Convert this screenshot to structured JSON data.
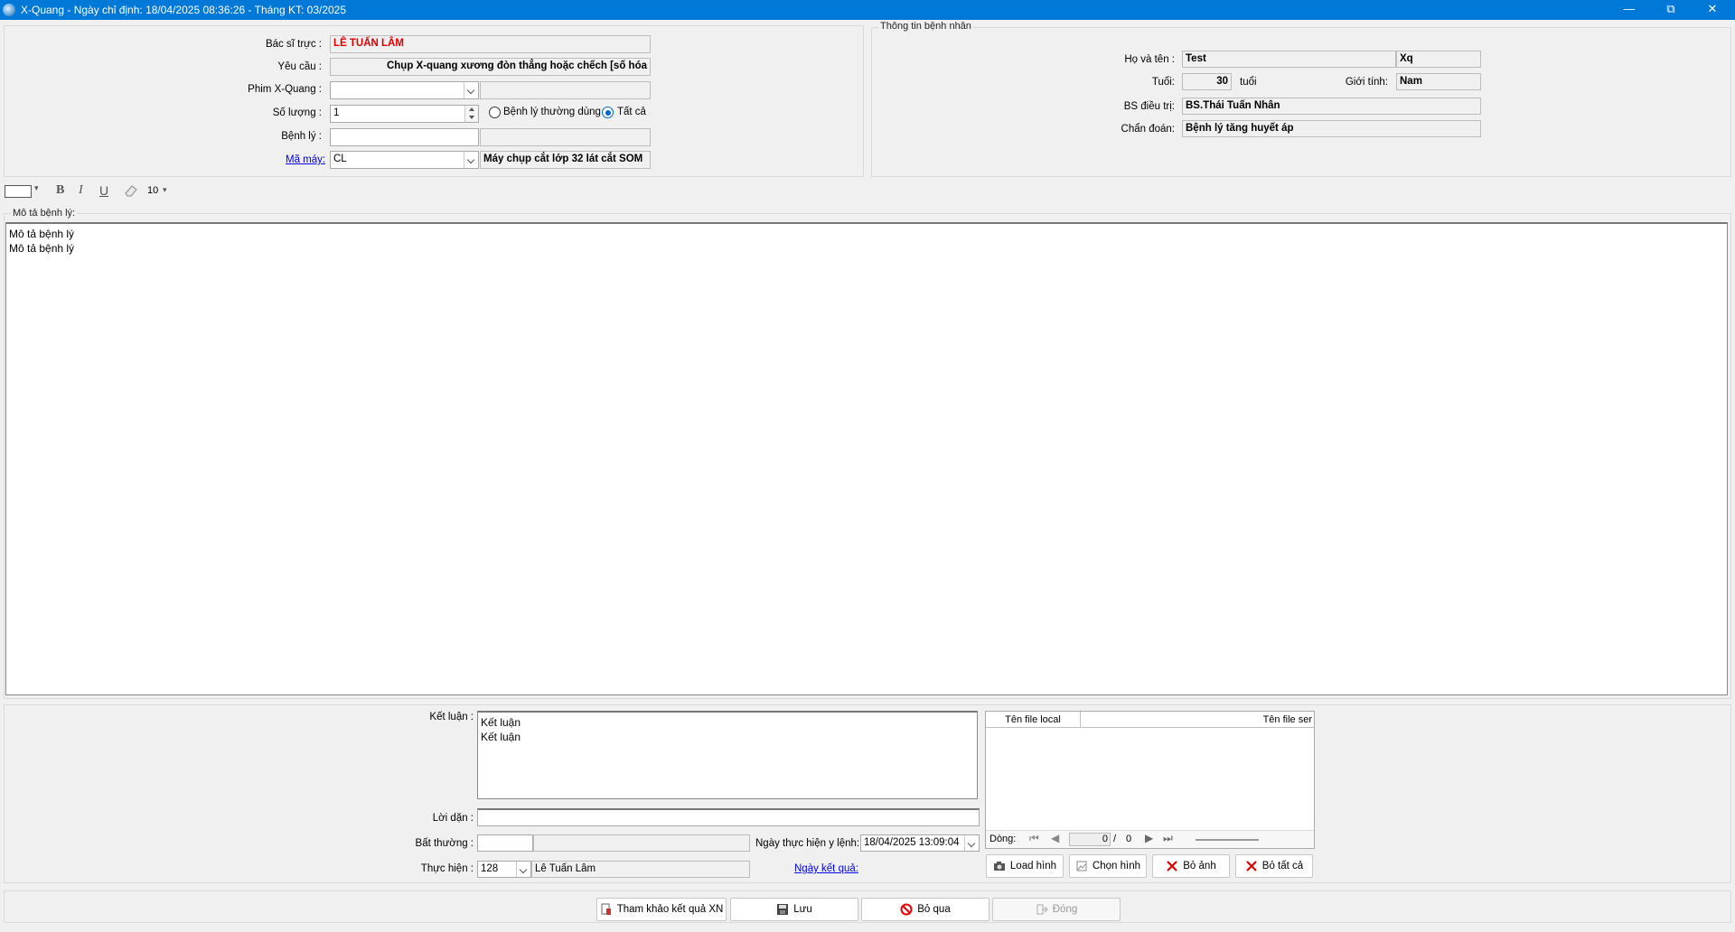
{
  "window": {
    "title": "X-Quang - Ngày chỉ định: 18/04/2025 08:36:26 - Tháng KT: 03/2025",
    "minimize": "—",
    "restore": "⧉",
    "close": "✕"
  },
  "order": {
    "bac_si_truc_label": "Bác sĩ trực :",
    "bac_si_truc_value": "LÊ TUẤN LÂM",
    "yeu_cau_label": "Yêu cầu :",
    "yeu_cau_value": "Chụp X-quang xương đòn thẳng hoặc chếch [số hóa",
    "phim_label": "Phim X-Quang :",
    "phim_value": "",
    "so_luong_label": "Số lượng :",
    "so_luong_value": "1",
    "radio_thuong_dung": "Bệnh lý thường dùng",
    "radio_tat_ca": "Tất cả",
    "benh_ly_label": "Bệnh lý :",
    "benh_ly_value": "",
    "ma_may_label": "Mã máy:",
    "ma_may_value": "CL",
    "ma_may_name": "Máy chụp cắt lớp 32 lát cắt SOM"
  },
  "patient": {
    "legend": "Thông tin bệnh nhân",
    "ho_ten_label": "Họ và tên :",
    "ho_ten_value": "Test",
    "ho_ten_value2": "Xq",
    "tuoi_label": "Tuổi:",
    "tuoi_value": "30",
    "tuoi_unit": "tuổi",
    "gioi_tinh_label": "Giới tính:",
    "gioi_tinh_value": "Nam",
    "bs_dieu_tri_label": "BS điều trị:",
    "bs_dieu_tri_value": "BS.Thái Tuấn Nhân",
    "chan_doan_label": "Chẩn đoán:",
    "chan_doan_value": "Bệnh lý tăng huyết áp"
  },
  "toolbar": {
    "bold": "B",
    "italic": "I",
    "underline": "U",
    "font_size": "10"
  },
  "description": {
    "legend": "Mô tả bệnh lý:",
    "lines": [
      "Mô tả bệnh lý",
      "Mô tả bệnh lý"
    ]
  },
  "result": {
    "ket_luan_label": "Kết luận :",
    "ket_luan_lines": [
      "Kết luận",
      "Kết luận"
    ],
    "loi_dan_label": "Lời dặn :",
    "loi_dan_value": "",
    "bat_thuong_label": "Bất thường :",
    "ngay_thuc_hien_label": "Ngày thực hiện y lệnh:",
    "ngay_thuc_hien_value": "18/04/2025 13:09:04",
    "thuc_hien_label": "Thực hiện :",
    "thuc_hien_code": "128",
    "thuc_hien_name": "Lê Tuấn Lâm",
    "ngay_ket_qua_link": "Ngày kết quả:"
  },
  "files": {
    "col_local": "Tên file local",
    "col_server": "Tên file ser",
    "nav_label": "Dòng:",
    "nav_current": "0",
    "nav_sep": "/",
    "nav_total": "0"
  },
  "image_buttons": {
    "load": "Load hình",
    "chon": "Chọn hình",
    "bo_anh": "Bỏ ảnh",
    "bo_tat_ca": "Bỏ tất cả"
  },
  "footer_buttons": {
    "tham_khao": "Tham khảo kết quả XN",
    "luu": "Lưu",
    "bo_qua": "Bỏ qua",
    "dong": "Đóng"
  }
}
